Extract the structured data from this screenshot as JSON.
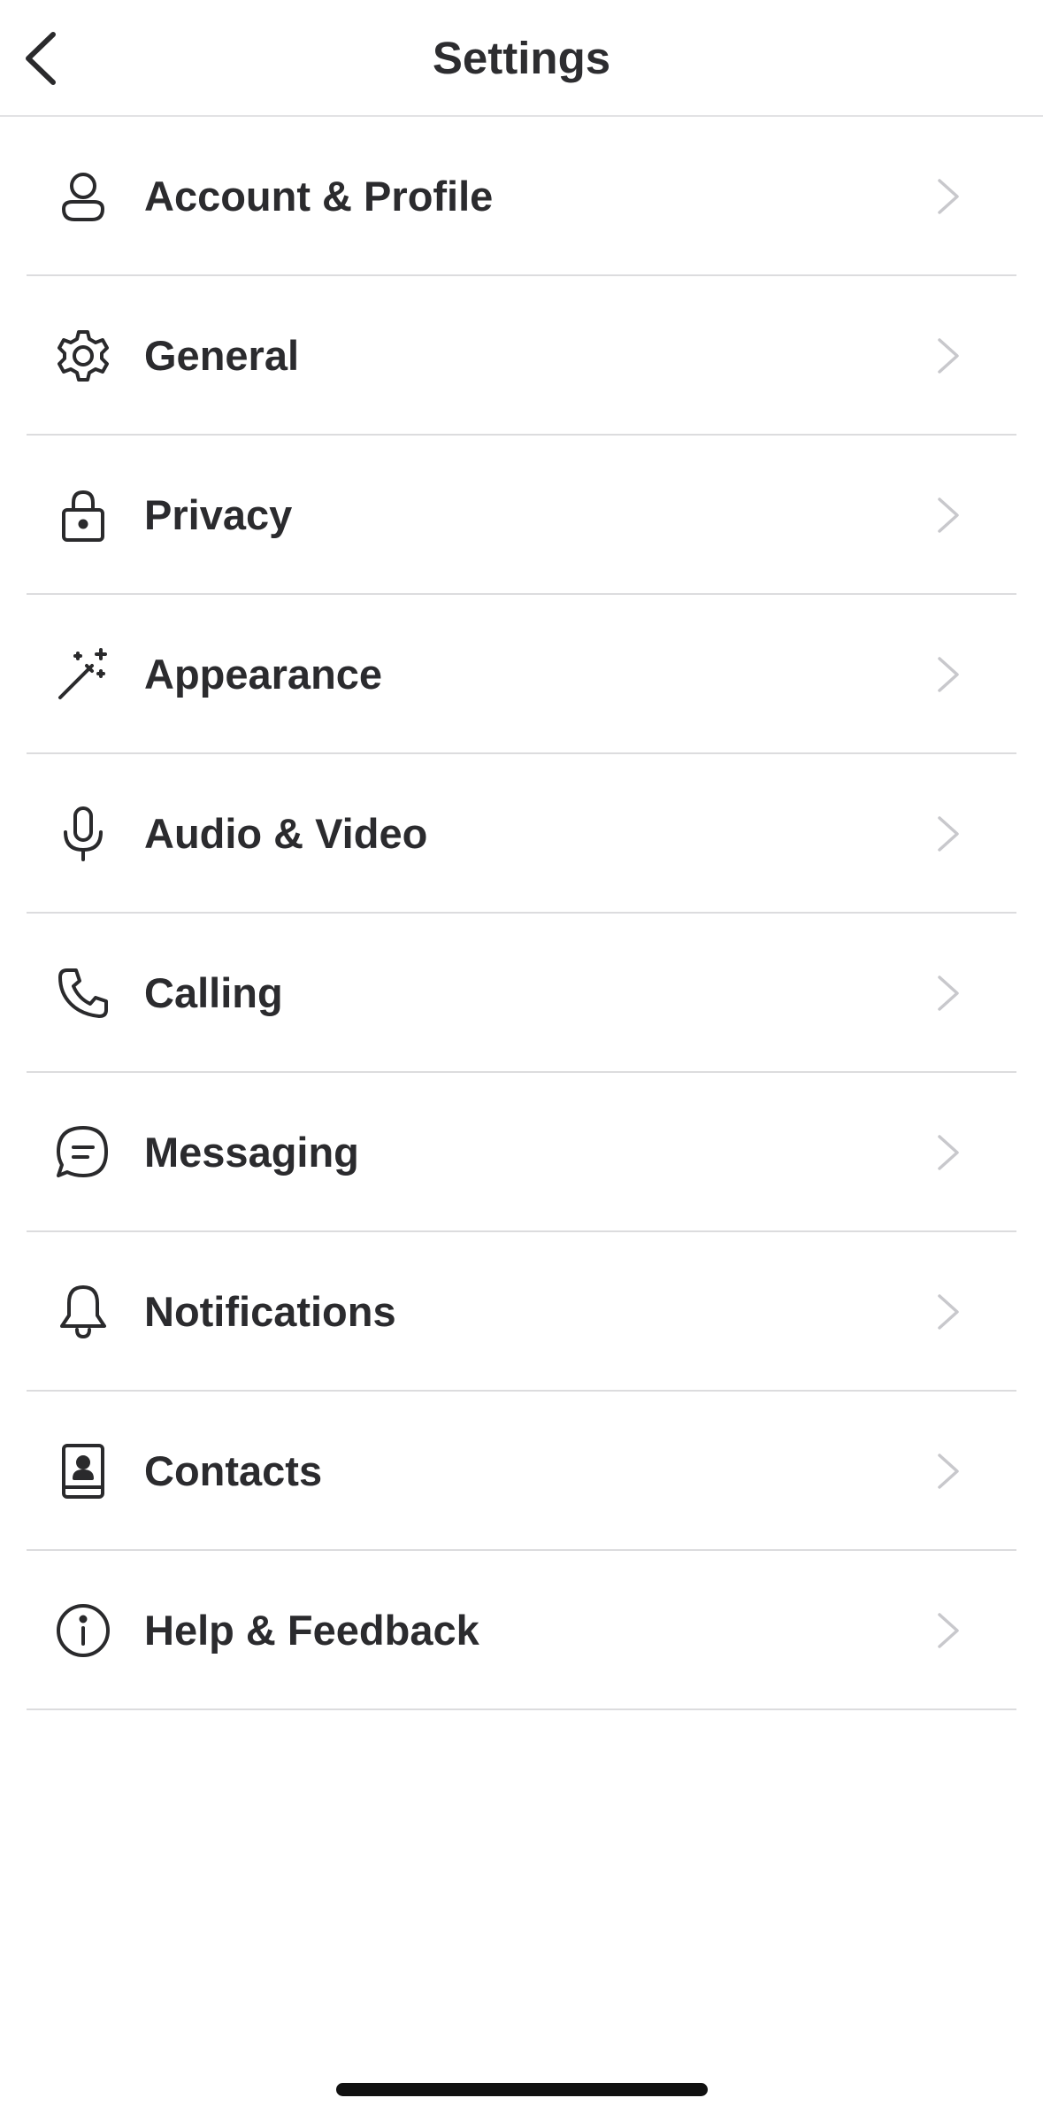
{
  "header": {
    "title": "Settings",
    "back_icon": "chevron-left-icon"
  },
  "settings": {
    "items": [
      {
        "label": "Account & Profile",
        "icon": "person-icon"
      },
      {
        "label": "General",
        "icon": "gear-icon"
      },
      {
        "label": "Privacy",
        "icon": "lock-icon"
      },
      {
        "label": "Appearance",
        "icon": "magic-wand-icon"
      },
      {
        "label": "Audio & Video",
        "icon": "microphone-icon"
      },
      {
        "label": "Calling",
        "icon": "phone-icon"
      },
      {
        "label": "Messaging",
        "icon": "chat-bubble-icon"
      },
      {
        "label": "Notifications",
        "icon": "bell-icon"
      },
      {
        "label": "Contacts",
        "icon": "contact-book-icon"
      },
      {
        "label": "Help & Feedback",
        "icon": "info-icon"
      }
    ],
    "chevron_icon": "chevron-right-icon"
  },
  "colors": {
    "text": "#2b2b2e",
    "divider": "#dcdcde",
    "chevron": "#c8c8cc",
    "background": "#ffffff",
    "home_indicator": "#111111"
  }
}
